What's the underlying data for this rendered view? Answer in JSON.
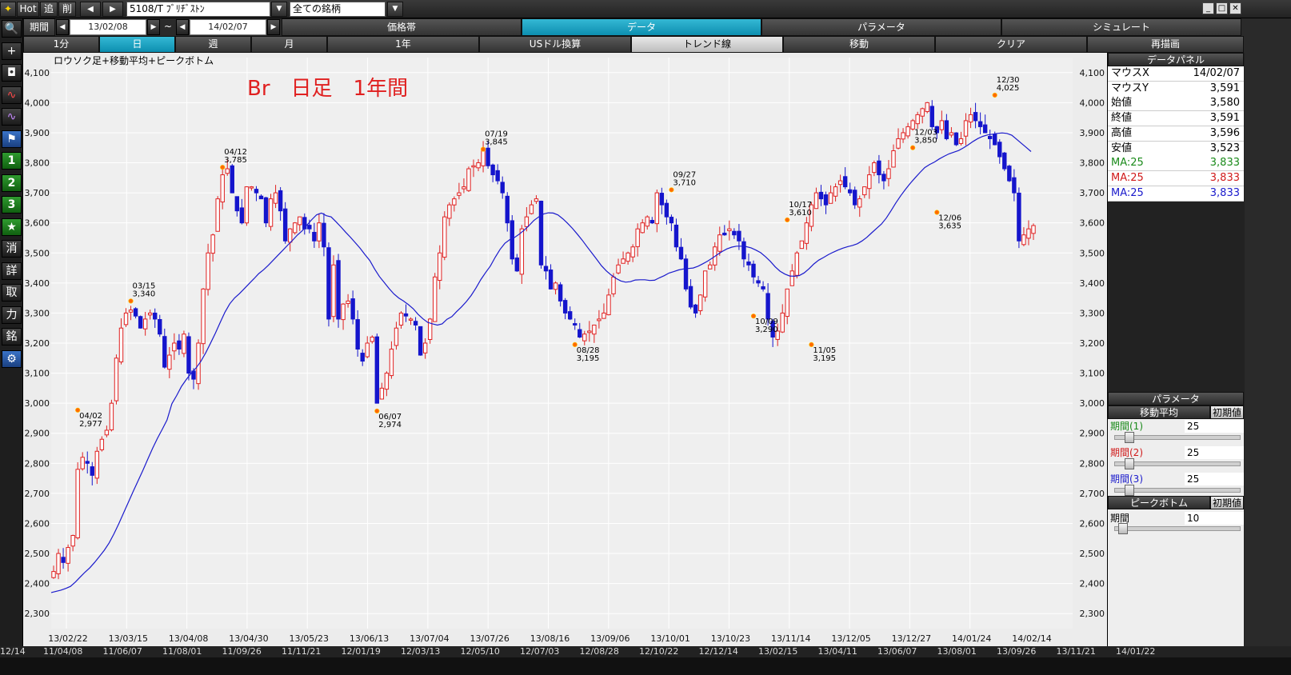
{
  "toolbar": {
    "hot": "Hot",
    "back": "追",
    "del": "削",
    "stock": "5108/T ﾌﾞﾘﾁﾞｽﾄﾝ",
    "market": "全ての銘柄"
  },
  "period": {
    "label": "期間",
    "from": "13/02/08",
    "tilde": "~",
    "to": "14/02/07"
  },
  "menu_tabs": [
    "価格帯",
    "データ",
    "パラメータ",
    "シミュレート"
  ],
  "menu_active": 1,
  "row2_buttons": [
    "1分",
    "日",
    "週",
    "月",
    "1年",
    "USドル換算",
    "トレンド線",
    "移動",
    "クリア",
    "再描画"
  ],
  "row2_active": 1,
  "left_tools": [
    {
      "icon": "search-icon",
      "label": "🔍"
    },
    {
      "icon": "plus-icon",
      "label": "+"
    },
    {
      "icon": "camera-icon",
      "label": "◘"
    },
    {
      "icon": "line-chart-red-icon",
      "label": "∿"
    },
    {
      "icon": "line-chart-purple-icon",
      "label": "∿"
    },
    {
      "icon": "flag-icon",
      "label": "⚑"
    },
    {
      "icon": "one-icon",
      "label": "1"
    },
    {
      "icon": "two-icon",
      "label": "2"
    },
    {
      "icon": "three-icon",
      "label": "3"
    },
    {
      "icon": "star-icon",
      "label": "★"
    },
    {
      "icon": "erase-icon",
      "label": "消"
    },
    {
      "icon": "detail-icon",
      "label": "詳"
    },
    {
      "icon": "trade-icon",
      "label": "取"
    },
    {
      "icon": "power-icon",
      "label": "力"
    },
    {
      "icon": "brand-icon",
      "label": "銘"
    },
    {
      "icon": "gear-icon",
      "label": "⚙"
    }
  ],
  "chart": {
    "caption": "ロウソク足+移動平均+ピークボトム",
    "annotation": "Br　日足　1年間",
    "annotation_color": "#e02020"
  },
  "chart_data": {
    "type": "candlestick",
    "ylim": [
      2250,
      4150
    ],
    "y_ticks": [
      2300,
      2400,
      2500,
      2600,
      2700,
      2800,
      2900,
      3000,
      3100,
      3200,
      3300,
      3400,
      3500,
      3600,
      3700,
      3800,
      3900,
      4000,
      4100
    ],
    "y_tick_labels": [
      "2,300",
      "2,400",
      "2,500",
      "2,600",
      "2,700",
      "2,800",
      "2,900",
      "3,000",
      "3,100",
      "3,200",
      "3,300",
      "3,400",
      "3,500",
      "3,600",
      "3,700",
      "3,800",
      "3,900",
      "4,000",
      "4,100"
    ],
    "x_dates": [
      "13/02/22",
      "13/03/15",
      "13/04/08",
      "13/04/30",
      "13/05/23",
      "13/06/13",
      "13/07/04",
      "13/07/26",
      "13/08/16",
      "13/09/06",
      "13/10/01",
      "13/10/23",
      "13/11/14",
      "13/12/05",
      "13/12/27",
      "14/01/24",
      "14/02/14"
    ],
    "grid": true,
    "ma_period": 25,
    "ma_color": "#1a1acc",
    "up_color": "#e02020",
    "down_color": "#1515cc",
    "peaks": [
      {
        "date": "03/15",
        "value": "3,340",
        "price": 3340,
        "type": "peak"
      },
      {
        "date": "04/02",
        "value": "2,977",
        "price": 2977,
        "type": "bottom"
      },
      {
        "date": "04/12",
        "value": "3,785",
        "price": 3785,
        "type": "peak"
      },
      {
        "date": "06/07",
        "value": "2,974",
        "price": 2974,
        "type": "bottom"
      },
      {
        "date": "07/19",
        "value": "3,845",
        "price": 3845,
        "type": "peak"
      },
      {
        "date": "08/28",
        "value": "3,195",
        "price": 3195,
        "type": "bottom"
      },
      {
        "date": "09/27",
        "value": "3,710",
        "price": 3710,
        "type": "peak"
      },
      {
        "date": "10/09",
        "value": "3,290",
        "price": 3290,
        "type": "bottom"
      },
      {
        "date": "10/17",
        "value": "3,610",
        "price": 3610,
        "type": "peak"
      },
      {
        "date": "11/05",
        "value": "3,195",
        "price": 3195,
        "type": "bottom"
      },
      {
        "date": "12/03",
        "value": "3,850",
        "price": 3850,
        "type": "peak"
      },
      {
        "date": "12/06",
        "value": "3,635",
        "price": 3635,
        "type": "bottom"
      },
      {
        "date": "12/30",
        "value": "4,025",
        "price": 4025,
        "type": "peak"
      }
    ],
    "closes": [
      2440,
      2500,
      2470,
      2520,
      2560,
      2780,
      2820,
      2800,
      2760,
      2840,
      2880,
      2910,
      3000,
      3150,
      3250,
      3300,
      3310,
      3290,
      3250,
      3280,
      3300,
      3280,
      3230,
      3120,
      3160,
      3200,
      3180,
      3230,
      3100,
      3080,
      3200,
      3380,
      3500,
      3560,
      3680,
      3760,
      3780,
      3700,
      3640,
      3600,
      3720,
      3720,
      3700,
      3680,
      3600,
      3680,
      3700,
      3640,
      3540,
      3580,
      3600,
      3620,
      3580,
      3580,
      3540,
      3600,
      3520,
      3280,
      3460,
      3280,
      3330,
      3340,
      3280,
      3180,
      3140,
      3200,
      3220,
      3000,
      3050,
      3100,
      3180,
      3250,
      3300,
      3290,
      3280,
      3260,
      3160,
      3200,
      3280,
      3420,
      3500,
      3620,
      3660,
      3680,
      3700,
      3720,
      3780,
      3790,
      3800,
      3840,
      3790,
      3760,
      3740,
      3700,
      3600,
      3480,
      3440,
      3580,
      3620,
      3660,
      3680,
      3460,
      3440,
      3380,
      3400,
      3340,
      3300,
      3280,
      3260,
      3220,
      3230,
      3240,
      3260,
      3280,
      3300,
      3360,
      3420,
      3460,
      3480,
      3500,
      3520,
      3580,
      3600,
      3620,
      3600,
      3700,
      3660,
      3620,
      3600,
      3520,
      3480,
      3380,
      3320,
      3300,
      3360,
      3440,
      3460,
      3520,
      3560,
      3560,
      3580,
      3560,
      3540,
      3480,
      3460,
      3420,
      3400,
      3380,
      3280,
      3220,
      3240,
      3300,
      3380,
      3440,
      3500,
      3540,
      3600,
      3660,
      3700,
      3680,
      3660,
      3700,
      3720,
      3740,
      3720,
      3700,
      3660,
      3680,
      3720,
      3760,
      3800,
      3760,
      3740,
      3780,
      3840,
      3880,
      3900,
      3920,
      3940,
      3960,
      3980,
      4000,
      3920,
      3900,
      3940,
      3880,
      3900,
      3860,
      3880,
      3940,
      3960,
      3940,
      3920,
      3900,
      3880,
      3860,
      3820,
      3780,
      3740,
      3700,
      3540,
      3560,
      3580,
      3591
    ]
  },
  "data_panel": {
    "title": "データパネル",
    "rows": [
      {
        "label": "マウスX",
        "value": "14/02/07"
      },
      {
        "label": "マウスY",
        "value": "3,591"
      },
      {
        "label": "始値",
        "value": "3,580"
      },
      {
        "label": "終値",
        "value": "3,591"
      },
      {
        "label": "高値",
        "value": "3,596"
      },
      {
        "label": "安値",
        "value": "3,523"
      },
      {
        "label": "MA:25",
        "value": "3,833",
        "color": "#1a8a1a"
      },
      {
        "label": "MA:25",
        "value": "3,833",
        "color": "#d01a1a"
      },
      {
        "label": "MA:25",
        "value": "3,833",
        "color": "#1a1acc"
      }
    ]
  },
  "param_panel": {
    "title": "パラメータ",
    "ma_label": "移動平均",
    "reset_label": "初期値",
    "periods": [
      {
        "label": "期間(1)",
        "value": "25",
        "color": "#1a8a1a"
      },
      {
        "label": "期間(2)",
        "value": "25",
        "color": "#d01a1a"
      },
      {
        "label": "期間(3)",
        "value": "25",
        "color": "#1a1acc"
      }
    ],
    "peak_label": "ピークボトム",
    "peak_reset": "初期値",
    "peak_period_label": "期間",
    "peak_period_value": "10"
  },
  "bottom_dates": [
    "12/14",
    "11/04/08",
    "11/06/07",
    "11/08/01",
    "11/09/26",
    "11/11/21",
    "12/01/19",
    "12/03/13",
    "12/05/10",
    "12/07/03",
    "12/08/28",
    "12/10/22",
    "12/12/14",
    "13/02/15",
    "13/04/11",
    "13/06/07",
    "13/08/01",
    "13/09/26",
    "13/11/21",
    "14/01/22"
  ]
}
